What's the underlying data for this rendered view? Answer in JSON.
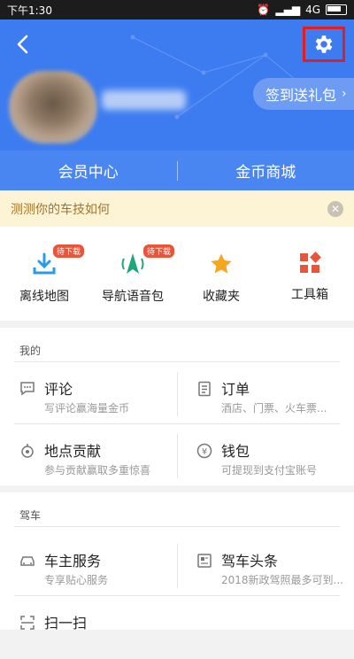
{
  "status_bar": {
    "time": "下午1:30",
    "network": "4G"
  },
  "header": {
    "signin_label": "签到送礼包",
    "tabs": [
      {
        "label": "会员中心"
      },
      {
        "label": "金币商城"
      }
    ]
  },
  "banner": {
    "text": "测测你的车技如何",
    "close": "✕"
  },
  "quick_actions": [
    {
      "label": "离线地图",
      "badge": "待下载",
      "icon": "download-icon"
    },
    {
      "label": "导航语音包",
      "badge": "待下载",
      "icon": "navigation-voice-icon"
    },
    {
      "label": "收藏夹",
      "badge": "",
      "icon": "star-icon"
    },
    {
      "label": "工具箱",
      "badge": "",
      "icon": "toolbox-icon"
    }
  ],
  "my_section": {
    "title": "我的",
    "items": [
      {
        "title": "评论",
        "subtitle": "写评论赢海量金币",
        "icon": "comment-icon"
      },
      {
        "title": "订单",
        "subtitle": "酒店、门票、火车票...",
        "icon": "order-icon"
      },
      {
        "title": "地点贡献",
        "subtitle": "参与贡献赢取多重惊喜",
        "icon": "location-contribution-icon"
      },
      {
        "title": "钱包",
        "subtitle": "可提现到支付宝账号",
        "icon": "wallet-icon"
      }
    ]
  },
  "drive_section": {
    "title": "驾车",
    "items": [
      {
        "title": "车主服务",
        "subtitle": "专享贴心服务",
        "icon": "car-icon"
      },
      {
        "title": "驾车头条",
        "subtitle": "2018新政驾照最多可到...",
        "icon": "news-icon"
      },
      {
        "title": "扫一扫",
        "subtitle": "",
        "icon": "scan-icon"
      }
    ]
  },
  "colors": {
    "accent": "#3d7cf0",
    "highlight_box": "#e02020",
    "banner_bg": "#fdf4d6"
  }
}
